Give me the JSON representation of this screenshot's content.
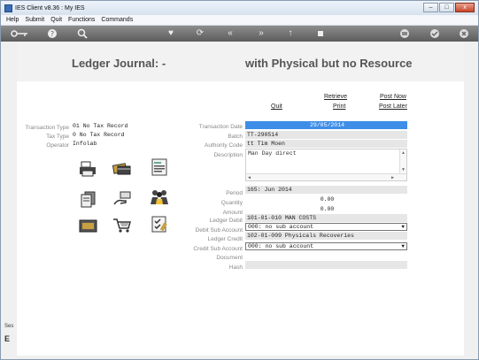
{
  "window": {
    "title": "IES Client v8.36 : My IES",
    "min_label": "–",
    "max_label": "□",
    "close_label": "x"
  },
  "menu": [
    "Help",
    "Submit",
    "Quit",
    "Functions",
    "Commands"
  ],
  "toolbar": {
    "icons": [
      "key-icon",
      "help-icon",
      "search-icon",
      "heart-icon",
      "refresh-icon",
      "rewind-icon",
      "forward-icon",
      "upload-icon",
      "stop-icon",
      "print-icon",
      "check-icon",
      "close-icon"
    ]
  },
  "header": {
    "title_left": "Ledger Journal: -",
    "title_right": "with Physical but no Resource"
  },
  "actions": {
    "retrieve": "Retrieve",
    "post_now": "Post Now",
    "quit": "Quit",
    "print": "Print",
    "post_later": "Post Later"
  },
  "left_info": {
    "transaction_type_label": "Transaction Type",
    "transaction_type": "01 No Tax Record",
    "tax_type_label": "Tax Type",
    "tax_type": "0 No Tax Record",
    "operator_label": "Operator",
    "operator": "Infolab"
  },
  "form": {
    "transaction_date_label": "Transaction Date",
    "transaction_date": "29/05/2014",
    "batch_label": "Batch",
    "batch": "TT-290514",
    "authority_code_label": "Authority Code",
    "authority_code": "tt Tim Moen",
    "description_label": "Description",
    "description": "Man Day direct",
    "period_label": "Period",
    "period": "165: Jun 2014",
    "quantity_label": "Quantity",
    "quantity": "0.00",
    "amount_label": "Amount",
    "amount": "0.00",
    "ledger_debit_label": "Ledger Debit",
    "ledger_debit": "101-01-010 MAN COSTS",
    "debit_sub_label": "Debit Sub Account",
    "debit_sub": "000: no sub account",
    "ledger_credit_label": "Ledger Credit",
    "ledger_credit": "102-01-009 Physicals Recoveries",
    "credit_sub_label": "Credit Sub Account",
    "credit_sub": "000: no sub account",
    "document_label": "Document",
    "document": "",
    "hash_label": "Hash",
    "hash": ""
  },
  "side": {
    "label": "Ses"
  }
}
